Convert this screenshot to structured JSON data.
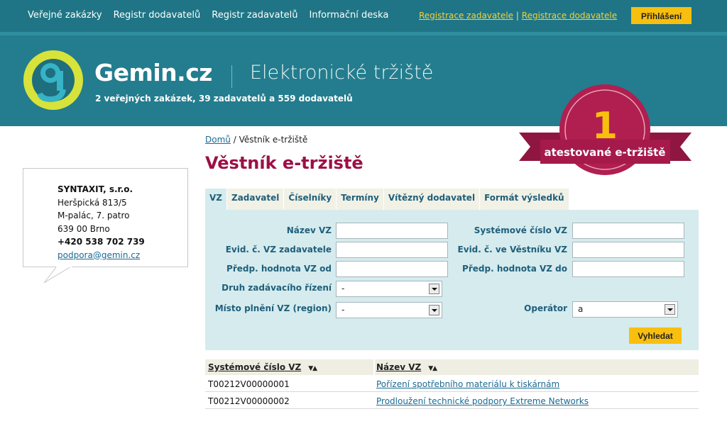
{
  "topnav": {
    "items": [
      "Veřejné zakázky",
      "Registr dodavatelů",
      "Registr zadavatelů",
      "Informační deska"
    ],
    "reg_zadavatel": "Registrace zadavatele",
    "separator": "|",
    "reg_dodavatel": "Registrace dodavatele",
    "login": "Přihlášení"
  },
  "header": {
    "brand": "Gemin.cz",
    "tagline": "Elektronické tržiště",
    "stats": "2 veřejných zakázek, 39 zadavatelů a 559 dodavatelů",
    "badge_number": "1",
    "badge_text": "atestované e-tržiště"
  },
  "contact": {
    "company": "SYNTAXIT, s.r.o.",
    "street": "Heršpická 813/5",
    "building": "M-palác, 7. patro",
    "city": "639 00  Brno",
    "phone": "+420 538 702 739",
    "email": "podpora@gemin.cz"
  },
  "breadcrumb": {
    "home": "Domů",
    "separator": " / ",
    "current": "Věstník e-tržiště"
  },
  "page_title": "Věstník e-tržiště",
  "tabs": [
    "VZ",
    "Zadavatel",
    "Číselníky",
    "Termíny",
    "Vítězný dodavatel",
    "Formát výsledků"
  ],
  "form": {
    "nazev_vz": "Název VZ",
    "systemove_cislo": "Systémové číslo VZ",
    "evid_zadavatel": "Evid. č. VZ zadavatele",
    "evid_vestnik": "Evid. č. ve Věstníku VZ",
    "hodnota_od": "Předp. hodnota VZ od",
    "hodnota_do": "Předp. hodnota VZ do",
    "druh_rizeni": "Druh zadávacího řízení",
    "druh_value": "-",
    "misto_plneni": "Místo plnění VZ (region)",
    "misto_value": "-",
    "operator": "Operátor",
    "operator_value": "a",
    "search": "Vyhledat"
  },
  "results": {
    "columns": [
      "Systémové číslo VZ",
      "Název VZ"
    ],
    "sort_icon": "▼▲",
    "rows": [
      {
        "id": "T00212V00000001",
        "name": "Pořízení spotřebního materiálu k tiskárnám"
      },
      {
        "id": "T00212V00000002",
        "name": "Prodloužení technické podpory Extreme Networks"
      }
    ]
  },
  "colors": {
    "header_teal": "#237d8e",
    "accent_yellow": "#f9bf0e",
    "title_magenta": "#9c1045",
    "badge_red": "#b01f50",
    "panel_bg": "#d6ebed"
  }
}
